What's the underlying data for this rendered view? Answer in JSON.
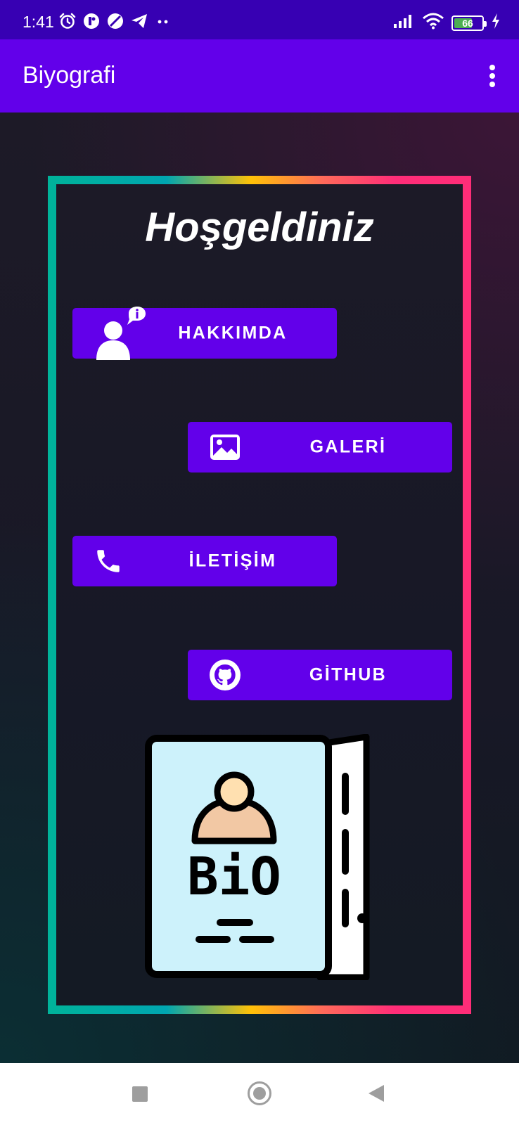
{
  "status_bar": {
    "time": "1:41",
    "battery_level": "66",
    "icons": [
      "alarm-icon",
      "app-icon",
      "circle-slash-icon",
      "telegram-icon",
      "more-dots-icon",
      "signal-icon",
      "wifi-icon",
      "battery-icon",
      "charging-icon"
    ]
  },
  "app_bar": {
    "title": "Biyografi",
    "menu_icon": "overflow-menu-icon"
  },
  "main": {
    "welcome": "Hoşgeldiniz",
    "buttons": [
      {
        "label": "HAKKIMDA",
        "icon": "person-info-icon"
      },
      {
        "label": "GALERİ",
        "icon": "image-icon"
      },
      {
        "label": "İLETİŞİM",
        "icon": "phone-icon"
      },
      {
        "label": "GİTHUB",
        "icon": "github-icon"
      }
    ],
    "illustration": {
      "icon": "bio-book-illustration",
      "text": "BiO"
    }
  },
  "colors": {
    "status_bar": "#3700b3",
    "app_bar": "#6200ea",
    "button": "#6200ea",
    "frame_gradient": [
      "#00b39a",
      "#ffc107",
      "#ff2d78"
    ]
  },
  "nav_bar": {
    "icons": [
      "recent-apps-icon",
      "home-icon",
      "back-icon"
    ]
  }
}
